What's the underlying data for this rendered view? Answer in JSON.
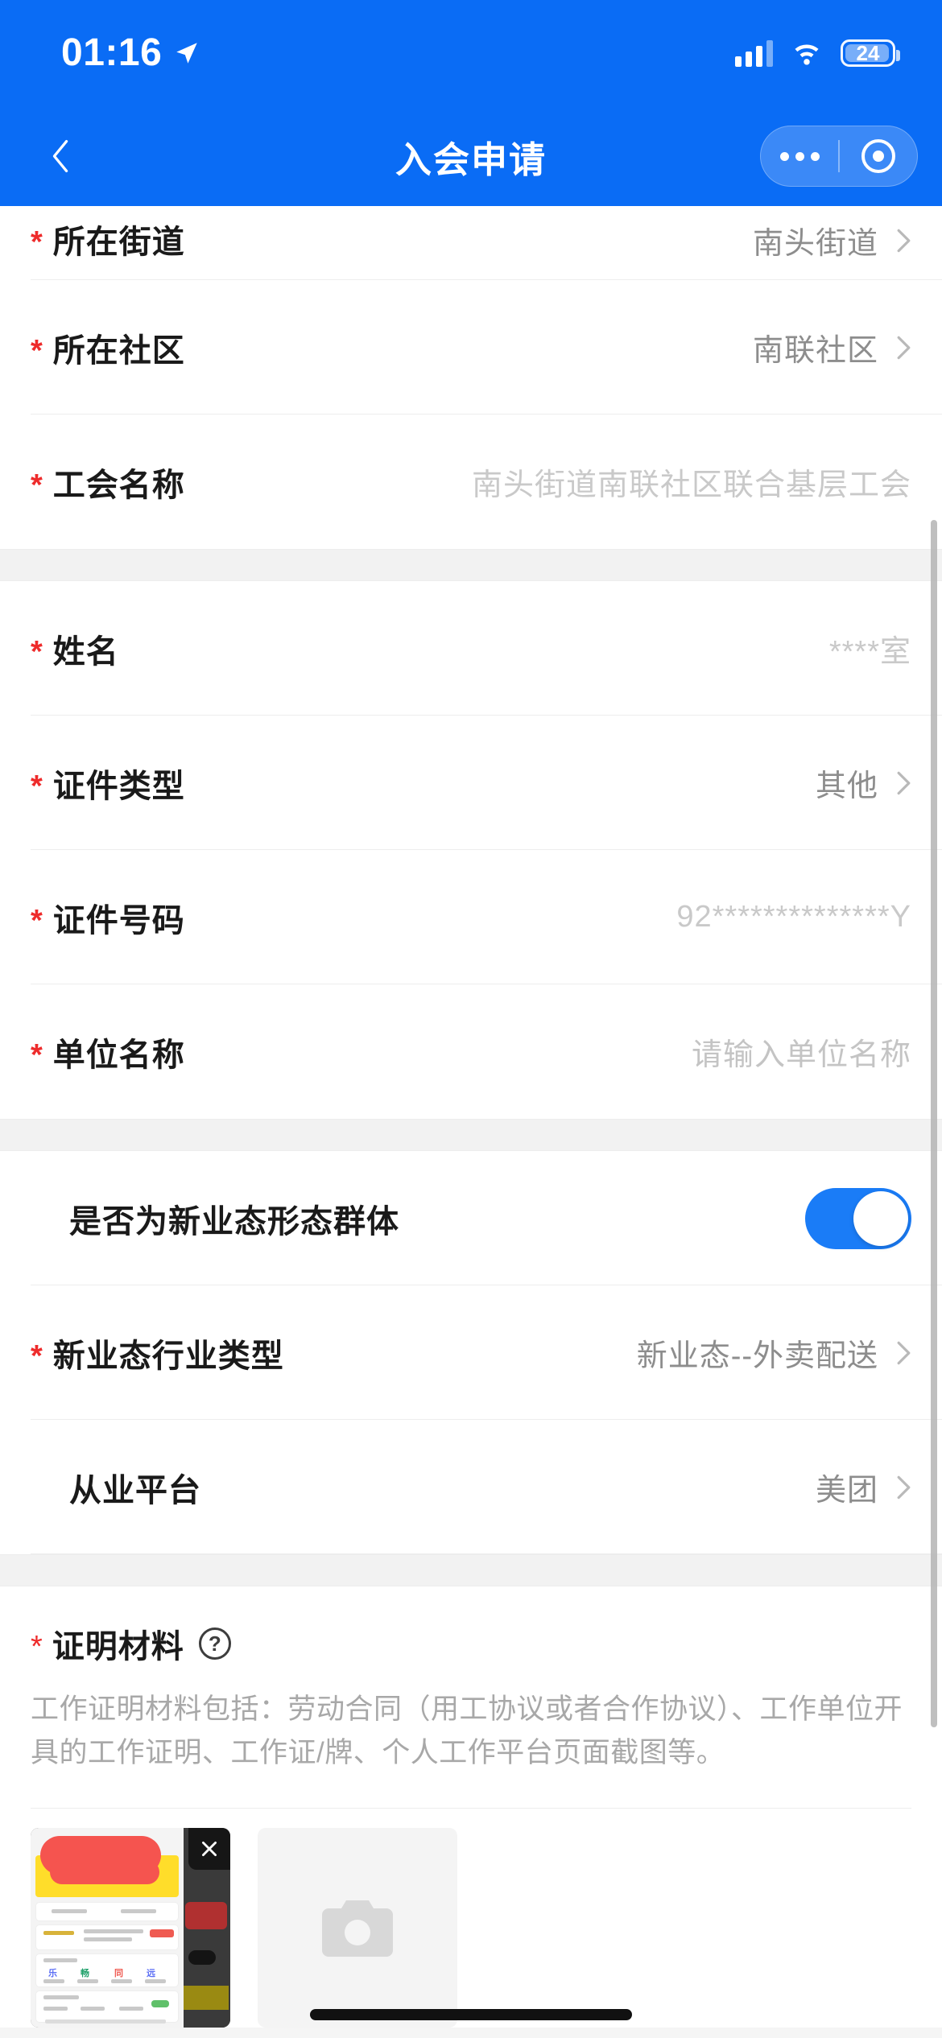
{
  "status_bar": {
    "time": "01:16",
    "location_icon": "location-arrow-icon",
    "signal_icon": "cellular-signal-icon",
    "wifi_icon": "wifi-icon",
    "battery_level": "24"
  },
  "nav": {
    "back_icon": "chevron-left-icon",
    "title": "入会申请",
    "more_icon": "more-dots-icon",
    "capsule_target_icon": "target-circle-icon"
  },
  "form": {
    "rows": [
      {
        "label": "所在街道",
        "required": true,
        "value": "南头街道",
        "chevron": true,
        "value_style": "normal"
      },
      {
        "label": "所在社区",
        "required": true,
        "value": "南联社区",
        "chevron": true,
        "value_style": "normal"
      },
      {
        "label": "工会名称",
        "required": true,
        "value": "南头街道南联社区联合基层工会",
        "chevron": false,
        "value_style": "light"
      },
      {
        "label": "姓名",
        "required": true,
        "value": "****室",
        "chevron": false,
        "value_style": "light"
      },
      {
        "label": "证件类型",
        "required": true,
        "value": "其他",
        "chevron": true,
        "value_style": "normal"
      },
      {
        "label": "证件号码",
        "required": true,
        "value": "92**************Y",
        "chevron": false,
        "value_style": "light"
      },
      {
        "label": "单位名称",
        "required": true,
        "value": "请输入单位名称",
        "chevron": false,
        "value_style": "placeholder"
      },
      {
        "label": "是否为新业态形态群体",
        "required": false,
        "value": "",
        "chevron": false,
        "value_style": "toggle",
        "toggle_on": true
      },
      {
        "label": "新业态行业类型",
        "required": true,
        "value": "新业态--外卖配送",
        "chevron": true,
        "value_style": "normal"
      },
      {
        "label": "从业平台",
        "required": false,
        "value": "美团",
        "chevron": true,
        "value_style": "normal"
      }
    ]
  },
  "proof": {
    "label": "证明材料",
    "required": true,
    "help_icon": "question-mark-icon",
    "help_glyph": "?",
    "description": "工作证明材料包括：劳动合同（用工协议或者合作协议）、工作单位开具的工作证明、工作证/牌、个人工作平台页面截图等。",
    "uploaded_thumbnail_name": "uploaded-proof-image",
    "remove_icon": "close-x-icon",
    "add_icon": "camera-icon"
  },
  "colors": {
    "brand_blue": "#0a6cf5",
    "toggle_on": "#1a7cf7",
    "required_red": "#ee2b2b",
    "label_text": "#1a1a1a",
    "value_text": "#8d8d8d",
    "placeholder_text": "#c4c4c4"
  }
}
